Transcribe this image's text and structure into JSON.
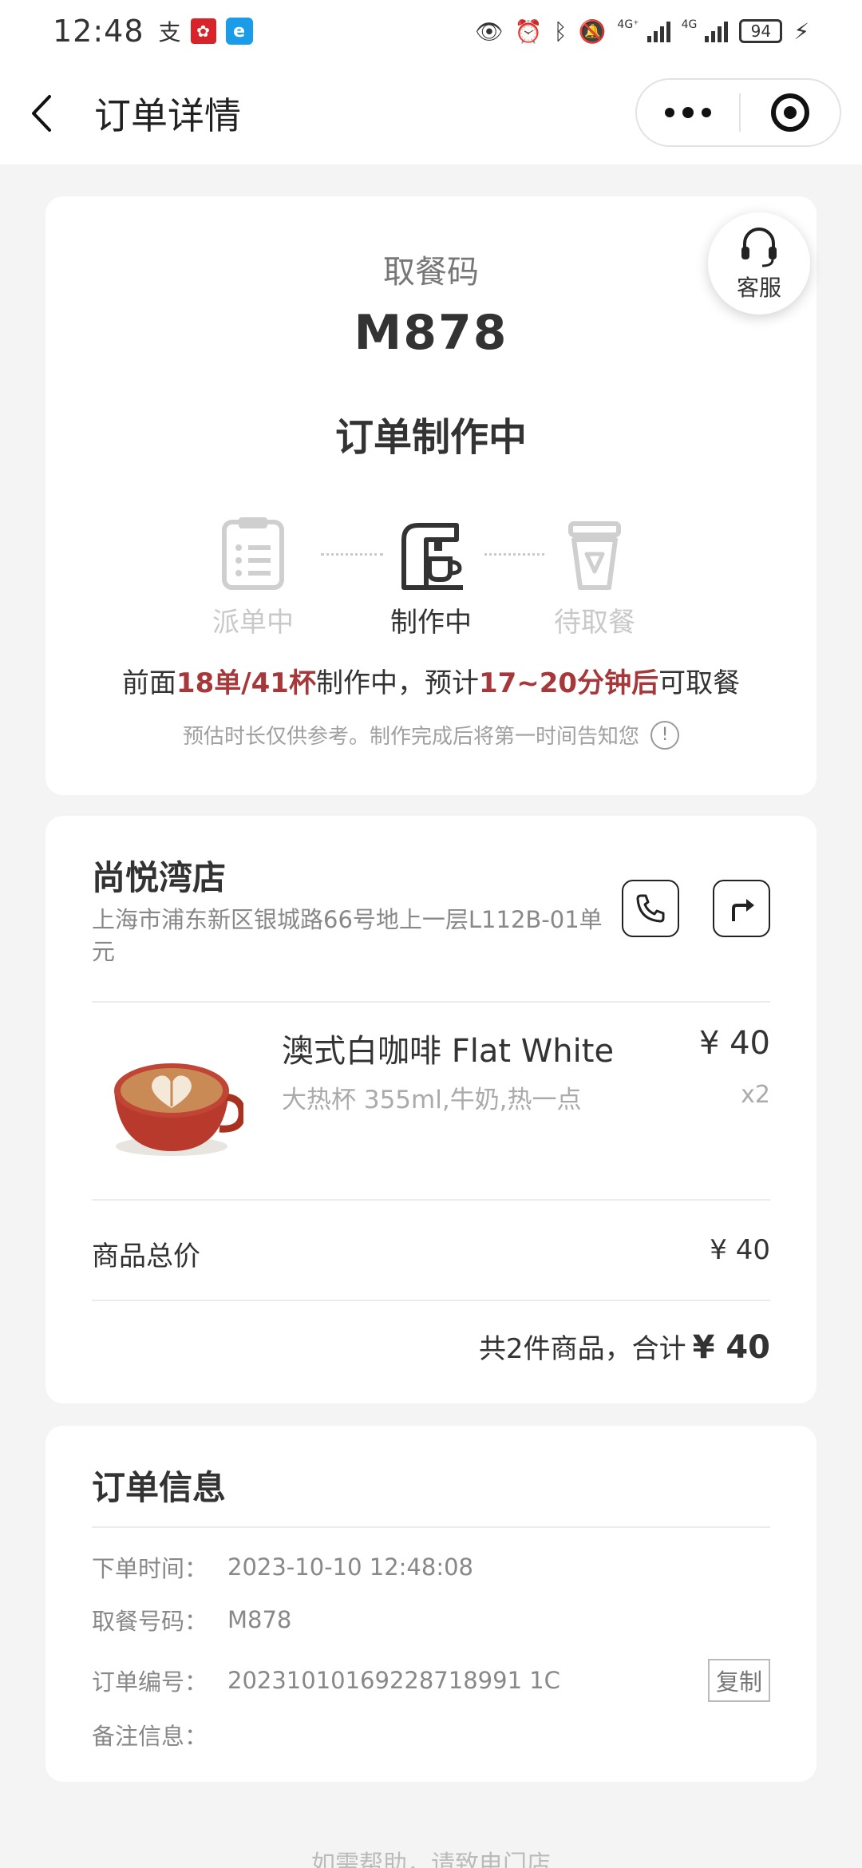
{
  "status_bar": {
    "time": "12:48",
    "battery": "94",
    "network_1": "4G⁺",
    "network_2": "4G"
  },
  "header": {
    "title": "订单详情"
  },
  "pickup": {
    "label": "取餐码",
    "code": "M878",
    "status": "订单制作中",
    "service_label": "客服"
  },
  "steps": [
    {
      "label": "派单中",
      "state": "inactive"
    },
    {
      "label": "制作中",
      "state": "active"
    },
    {
      "label": "待取餐",
      "state": "inactive"
    }
  ],
  "queue": {
    "prefix": "前面",
    "orders": "18单/41杯",
    "middle": "制作中，预计",
    "eta": "17~20分钟后",
    "suffix": "可取餐"
  },
  "note": "预估时长仅供参考。制作完成后将第一时间告知您",
  "store": {
    "name": "尚悦湾店",
    "address": "上海市浦东新区银城路66号地上一层L112B-01单元"
  },
  "product": {
    "name": "澳式白咖啡 Flat White",
    "spec": "大热杯 355ml,牛奶,热一点",
    "price": "¥ 40",
    "qty": "x2"
  },
  "summary": {
    "subtotal_label": "商品总价",
    "subtotal_value": "¥ 40",
    "total_text": "共2件商品，合计",
    "total_amount": "¥ 40"
  },
  "order_info": {
    "title": "订单信息",
    "rows": [
      {
        "label": "下单时间：",
        "value": "2023-10-10 12:48:08"
      },
      {
        "label": "取餐号码：",
        "value": "M878"
      },
      {
        "label": "订单编号：",
        "value": "20231010169228718991 1C"
      },
      {
        "label": "备注信息：",
        "value": ""
      }
    ],
    "copy_label": "复制"
  },
  "footer": "如需帮助，请致电门店",
  "colors": {
    "highlight": "#a6373a",
    "background": "#f4f4f4",
    "card": "#ffffff"
  }
}
